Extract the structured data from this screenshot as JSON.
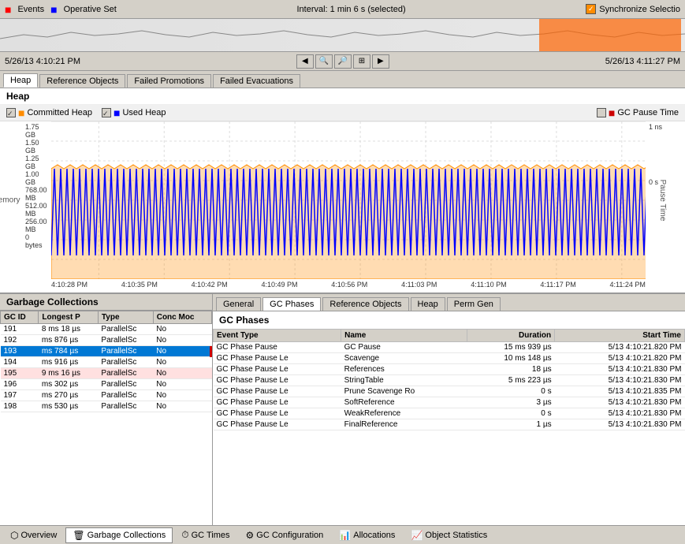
{
  "topbar": {
    "events_label": "Events",
    "operative_set_label": "Operative Set",
    "interval_label": "Interval: 1 min 6 s (selected)",
    "sync_label": "Synchronize Selectio"
  },
  "dates": {
    "left": "5/26/13 4:10:21 PM",
    "right": "5/26/13 4:11:27 PM"
  },
  "tabs": [
    "Heap",
    "Reference Objects",
    "Failed Promotions",
    "Failed Evacuations"
  ],
  "active_tab": 0,
  "chart": {
    "title": "Heap",
    "legend": {
      "committed_label": "Committed Heap",
      "used_label": "Used Heap",
      "gc_pause_label": "GC Pause Time"
    },
    "y_axis_labels": [
      "1.75 GB",
      "1.50 GB",
      "1.25 GB",
      "1.00 GB",
      "768.00 MB",
      "512.00 MB",
      "256.00 MB",
      "0 bytes"
    ],
    "y_axis_left_title": "Memory",
    "y_axis_right_labels": [
      "1 ns",
      "",
      "",
      "",
      "",
      "",
      "",
      "0 s"
    ],
    "y_axis_right_title": "Pause Time",
    "x_axis_labels": [
      "4:10:28 PM",
      "4:10:35 PM",
      "4:10:42 PM",
      "4:10:49 PM",
      "4:10:56 PM",
      "4:11:03 PM",
      "4:11:10 PM",
      "4:11:17 PM",
      "4:11:24 PM"
    ]
  },
  "gc_panel": {
    "title": "Garbage Collections",
    "columns": [
      "GC ID",
      "Longest P",
      "Type",
      "Conc Moc"
    ],
    "rows": [
      {
        "id": "191",
        "longest": "8 ms 18 µs",
        "type": "ParallelSc",
        "conc": "No",
        "selected": false
      },
      {
        "id": "192",
        "longest": "ms 876 µs",
        "type": "ParallelSc",
        "conc": "No",
        "selected": false
      },
      {
        "id": "193",
        "longest": "ms 784 µs",
        "type": "ParallelSc",
        "conc": "No",
        "selected": true,
        "highlight": true
      },
      {
        "id": "194",
        "longest": "ms 916 µs",
        "type": "ParallelSc",
        "conc": "No",
        "selected": false
      },
      {
        "id": "195",
        "longest": "9 ms 16 µs",
        "type": "ParallelSc",
        "conc": "No",
        "selected": false,
        "highlight": true
      },
      {
        "id": "196",
        "longest": "ms 302 µs",
        "type": "ParallelSc",
        "conc": "No",
        "selected": false
      },
      {
        "id": "197",
        "longest": "ms 270 µs",
        "type": "ParallelSc",
        "conc": "No",
        "selected": false
      },
      {
        "id": "198",
        "longest": "ms 530 µs",
        "type": "ParallelSc",
        "conc": "No",
        "selected": false
      }
    ]
  },
  "detail_tabs": [
    "General",
    "GC Phases",
    "Reference Objects",
    "Heap",
    "Perm Gen"
  ],
  "active_detail_tab": 1,
  "gc_phases": {
    "title": "GC Phases",
    "columns": [
      "Event Type",
      "Name",
      "Duration",
      "Start Time"
    ],
    "rows": [
      {
        "event_type": "GC Phase Pause",
        "name": "GC Pause",
        "duration": "15 ms 939 µs",
        "start_time": "5/13 4:10:21.820 PM"
      },
      {
        "event_type": "GC Phase Pause Le",
        "name": "Scavenge",
        "duration": "10 ms 148 µs",
        "start_time": "5/13 4:10:21.820 PM"
      },
      {
        "event_type": "GC Phase Pause Le",
        "name": "References",
        "duration": "18 µs",
        "start_time": "5/13 4:10:21.830 PM"
      },
      {
        "event_type": "GC Phase Pause Le",
        "name": "StringTable",
        "duration": "5 ms 223 µs",
        "start_time": "5/13 4:10:21.830 PM"
      },
      {
        "event_type": "GC Phase Pause Le",
        "name": "Prune Scavenge Ro",
        "duration": "0 s",
        "start_time": "5/13 4:10:21.835 PM"
      },
      {
        "event_type": "GC Phase Pause Le",
        "name": "SoftReference",
        "duration": "3 µs",
        "start_time": "5/13 4:10:21.830 PM"
      },
      {
        "event_type": "GC Phase Pause Le",
        "name": "WeakReference",
        "duration": "0 s",
        "start_time": "5/13 4:10:21.830 PM"
      },
      {
        "event_type": "GC Phase Pause Le",
        "name": "FinalReference",
        "duration": "1 µs",
        "start_time": "5/13 4:10:21.830 PM"
      }
    ]
  },
  "toolbar": {
    "items": [
      {
        "label": "Overview",
        "icon": "⬡"
      },
      {
        "label": "Garbage Collections",
        "icon": "🗑"
      },
      {
        "label": "GC Times",
        "icon": "⏱"
      },
      {
        "label": "GC Configuration",
        "icon": "⚙"
      },
      {
        "label": "Allocations",
        "icon": "📊"
      },
      {
        "label": "Object Statistics",
        "icon": "📈"
      }
    ],
    "active_item": 1
  }
}
